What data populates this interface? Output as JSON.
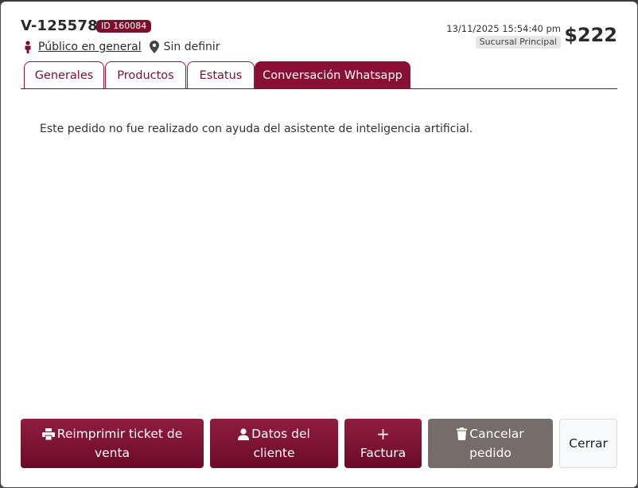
{
  "order": {
    "code": "V-125578",
    "id_badge": "ID 160084",
    "customer": "Público en general",
    "location": "Sin definir",
    "datetime": "13/11/2025 15:54:40 pm",
    "branch": "Sucursal Principal",
    "total": "$222"
  },
  "tabs": [
    {
      "label": "Generales"
    },
    {
      "label": "Productos"
    },
    {
      "label": "Estatus"
    },
    {
      "label": "Conversación Whatsapp",
      "active": true
    }
  ],
  "content": {
    "message": "Este pedido no fue realizado con ayuda del asistente de inteligencia artificial."
  },
  "buttons": {
    "reprint": {
      "line1": "Reimprimir ticket de",
      "line2": "venta",
      "icon": "printer-icon"
    },
    "client": {
      "line1": "Datos del",
      "line2": "cliente",
      "icon": "user-icon"
    },
    "invoice": {
      "line1": "+",
      "line2": "Factura",
      "icon": "plus-icon"
    },
    "cancel": {
      "line1": "Cancelar",
      "line2": "pedido",
      "icon": "trash-icon"
    },
    "close": {
      "label": "Cerrar"
    }
  },
  "colors": {
    "accent": "#7a0f2e",
    "cancel": "#766c69",
    "close_bg": "#f8f9fa"
  }
}
